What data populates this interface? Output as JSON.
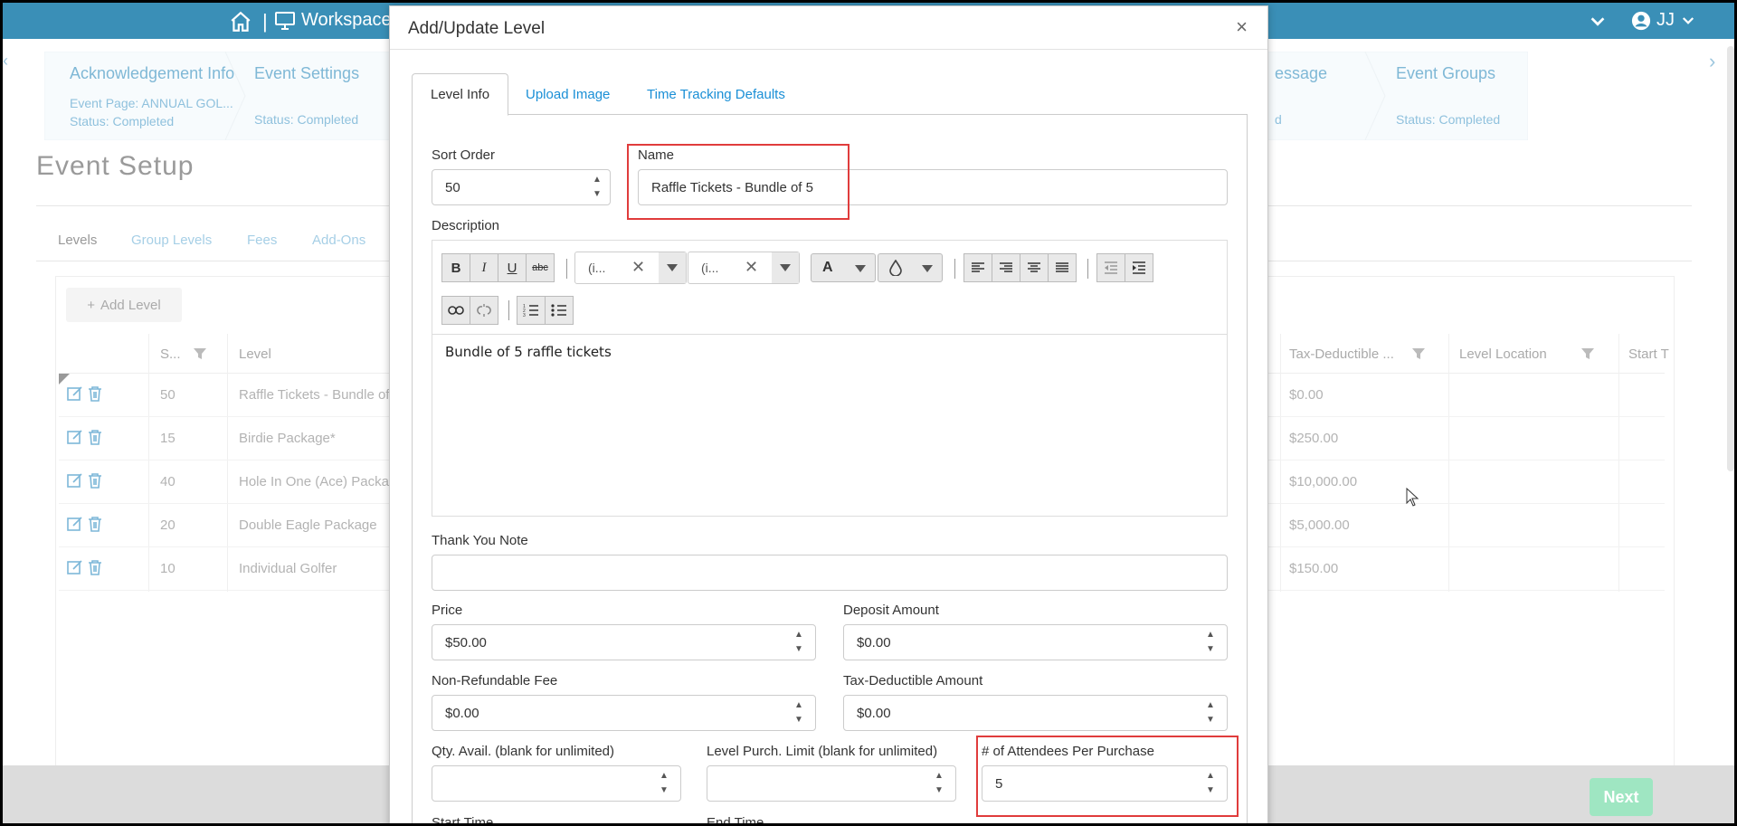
{
  "topbar": {
    "workspace_label": "Workspace",
    "separator": "|",
    "user_initials": "JJ"
  },
  "steps": [
    {
      "title": "Acknowledgement Info",
      "line1": "Event Page: ANNUAL GOL...",
      "status": "Status: Completed"
    },
    {
      "title": "Event Settings",
      "line1": "",
      "status": "Status: Completed"
    },
    {
      "title": "essage",
      "line1": "",
      "status": "d"
    },
    {
      "title": "Event Groups",
      "line1": "",
      "status": "Status: Completed"
    }
  ],
  "page": {
    "title": "Event Setup",
    "tabs": [
      "Levels",
      "Group Levels",
      "Fees",
      "Add-Ons"
    ],
    "add_level_label": "Add Level",
    "grid_headers": {
      "sort": "S...",
      "level": "Level",
      "tax": "Tax-Deductible ...",
      "location": "Level Location",
      "start": "Start T"
    },
    "rows": [
      {
        "sort": "50",
        "level": "Raffle Tickets - Bundle of",
        "tax": "$0.00"
      },
      {
        "sort": "15",
        "level": "Birdie Package*",
        "tax": "$250.00"
      },
      {
        "sort": "40",
        "level": "Hole In One (Ace) Packag",
        "tax": "$10,000.00"
      },
      {
        "sort": "20",
        "level": "Double Eagle Package",
        "tax": "$5,000.00"
      },
      {
        "sort": "10",
        "level": "Individual Golfer",
        "tax": "$150.00"
      }
    ],
    "next_label": "Next"
  },
  "modal": {
    "title": "Add/Update Level",
    "close_glyph": "×",
    "tabs": [
      "Level Info",
      "Upload Image",
      "Time Tracking Defaults"
    ],
    "sort_order": {
      "label": "Sort Order",
      "value": "50"
    },
    "name": {
      "label": "Name",
      "value": "Raffle Tickets - Bundle of 5"
    },
    "description": {
      "label": "Description",
      "content": "Bundle of 5 raffle tickets",
      "font_family_short": "(i...",
      "font_size_short": "(i..."
    },
    "thank_you": {
      "label": "Thank You Note",
      "value": ""
    },
    "price": {
      "label": "Price",
      "value": "$50.00"
    },
    "deposit": {
      "label": "Deposit Amount",
      "value": "$0.00"
    },
    "nonrefundable": {
      "label": "Non-Refundable Fee",
      "value": "$0.00"
    },
    "tax_deductible": {
      "label": "Tax-Deductible Amount",
      "value": "$0.00"
    },
    "qty_avail": {
      "label": "Qty. Avail. (blank for unlimited)",
      "value": ""
    },
    "purch_limit": {
      "label": "Level Purch. Limit (blank for unlimited)",
      "value": ""
    },
    "attendees": {
      "label": "# of Attendees Per Purchase",
      "value": "5"
    },
    "start_time": {
      "label": "Start Time"
    },
    "end_time": {
      "label": "End Time"
    }
  },
  "colors": {
    "topbar": "#3a8fb7",
    "link": "#1a8fd6",
    "highlight": "#e03c3c",
    "next_button": "#9fe6c2"
  }
}
